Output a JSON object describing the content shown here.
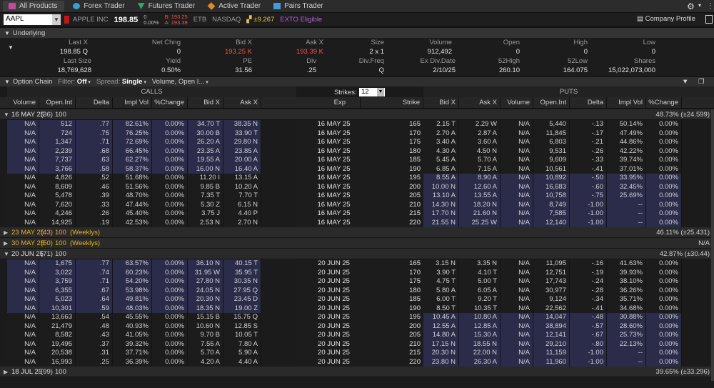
{
  "tabs": [
    {
      "label": "All Products"
    },
    {
      "label": "Forex Trader"
    },
    {
      "label": "Futures Trader"
    },
    {
      "label": "Active Trader"
    },
    {
      "label": "Pairs Trader"
    }
  ],
  "ticker": {
    "symbol": "AAPL",
    "name": "APPLE INC",
    "price": "198.85",
    "change": "0",
    "change_pct": "0.00%",
    "bid": "B: 193.25",
    "ask": "A: 193.39",
    "etb": "ETB",
    "exchange": "NASDAQ",
    "move": "±9.267",
    "exto": "EXTO Eligible",
    "company_profile": "Company Profile"
  },
  "underlying": {
    "title": "Underlying",
    "row1": [
      {
        "k": "Last X",
        "v": "198.85 Q"
      },
      {
        "k": "Net Chng",
        "v": "0"
      },
      {
        "k": "Bid X",
        "v": "193.25 K",
        "red": true
      },
      {
        "k": "Ask X",
        "v": "193.39 K",
        "red": true
      },
      {
        "k": "Size",
        "v": "2 x 1"
      },
      {
        "k": "Volume",
        "v": "912,492"
      },
      {
        "k": "Open",
        "v": "0"
      },
      {
        "k": "High",
        "v": "0"
      },
      {
        "k": "Low",
        "v": "0"
      }
    ],
    "row2": [
      {
        "k": "Last Size",
        "v": "18,769,628"
      },
      {
        "k": "Yield",
        "v": "0.50%"
      },
      {
        "k": "PE",
        "v": "31.56"
      },
      {
        "k": "Div",
        "v": ".25"
      },
      {
        "k": "Div.Freq",
        "v": "Q"
      },
      {
        "k": "Ex Div.Date",
        "v": "2/10/25"
      },
      {
        "k": "52High",
        "v": "260.10"
      },
      {
        "k": "52Low",
        "v": "164.075"
      },
      {
        "k": "Shares",
        "v": "15,022,073,000"
      },
      {
        "k": "Beta",
        "v": "1.276"
      }
    ]
  },
  "option_chain": {
    "title": "Option Chain",
    "filter_label": "Filter:",
    "filter": "Off",
    "spread_label": "Spread:",
    "spread": "Single",
    "layout": "Volume, Open I...",
    "calls": "CALLS",
    "puts": "PUTS",
    "strikes_label": "Strikes:",
    "strikes": "12"
  },
  "headers": {
    "calls": [
      "Volume",
      "Open.Int",
      "Delta",
      "Impl Vol",
      "%Change",
      "Bid X",
      "Ask X"
    ],
    "mid": [
      "Exp",
      "Strike"
    ],
    "puts": [
      "Bid X",
      "Ask X",
      "Volume",
      "Open.Int",
      "Delta",
      "Impl Vol",
      "%Change"
    ]
  },
  "groups": [
    {
      "date": "16 MAY 25",
      "days": "(36)",
      "mult": "100",
      "weekly": "",
      "iv": "48.73% (±24.599)",
      "open": true,
      "gold": false,
      "rows": [
        {
          "c": [
            "N/A",
            "512",
            ".77",
            "82.61%",
            "0.00%",
            "34.70 T",
            "38.35 N"
          ],
          "exp": "16 MAY 25",
          "strike": "165",
          "p": [
            "2.15 T",
            "2.29 W",
            "N/A",
            "5,440",
            "-.13",
            "50.14%",
            "0.00%"
          ]
        },
        {
          "c": [
            "N/A",
            "724",
            ".75",
            "76.25%",
            "0.00%",
            "30.00 B",
            "33.90 T"
          ],
          "exp": "16 MAY 25",
          "strike": "170",
          "p": [
            "2.70 A",
            "2.87 A",
            "N/A",
            "11,845",
            "-.17",
            "47.49%",
            "0.00%"
          ]
        },
        {
          "c": [
            "N/A",
            "1,347",
            ".71",
            "72.69%",
            "0.00%",
            "26.20 A",
            "29.80 N"
          ],
          "exp": "16 MAY 25",
          "strike": "175",
          "p": [
            "3.40 A",
            "3.60 A",
            "N/A",
            "6,803",
            "-.21",
            "44.86%",
            "0.00%"
          ]
        },
        {
          "c": [
            "N/A",
            "2,239",
            ".68",
            "66.45%",
            "0.00%",
            "23.35 A",
            "23.85 A"
          ],
          "exp": "16 MAY 25",
          "strike": "180",
          "p": [
            "4.30 A",
            "4.50 N",
            "N/A",
            "9,531",
            "-.26",
            "42.22%",
            "0.00%"
          ]
        },
        {
          "c": [
            "N/A",
            "7,737",
            ".63",
            "62.27%",
            "0.00%",
            "19.55 A",
            "20.00 A"
          ],
          "exp": "16 MAY 25",
          "strike": "185",
          "p": [
            "5.45 A",
            "5.70 A",
            "N/A",
            "9,609",
            "-.33",
            "39.74%",
            "0.00%"
          ]
        },
        {
          "c": [
            "N/A",
            "3,766",
            ".58",
            "58.37%",
            "0.00%",
            "16.00 N",
            "16.40 A"
          ],
          "exp": "16 MAY 25",
          "strike": "190",
          "p": [
            "6.85 A",
            "7.15 A",
            "N/A",
            "10,561",
            "-.41",
            "37.01%",
            "0.00%"
          ]
        },
        {
          "c": [
            "N/A",
            "4,826",
            ".52",
            "51.68%",
            "0.00%",
            "11.20 I",
            "13.15 A"
          ],
          "exp": "16 MAY 25",
          "strike": "195",
          "p": [
            "8.55 A",
            "8.90 A",
            "N/A",
            "10,892",
            "-.50",
            "33.95%",
            "0.00%"
          ]
        },
        {
          "c": [
            "N/A",
            "8,609",
            ".46",
            "51.56%",
            "0.00%",
            "9.85 B",
            "10.20 A"
          ],
          "exp": "16 MAY 25",
          "strike": "200",
          "p": [
            "10.00 N",
            "12.60 A",
            "N/A",
            "16,683",
            "-.60",
            "32.45%",
            "0.00%"
          ]
        },
        {
          "c": [
            "N/A",
            "5,478",
            ".39",
            "48.70%",
            "0.00%",
            "7.35 T",
            "7.70 T"
          ],
          "exp": "16 MAY 25",
          "strike": "205",
          "p": [
            "13.10 A",
            "13.55 A",
            "N/A",
            "10,758",
            "-.75",
            "25.69%",
            "0.00%"
          ]
        },
        {
          "c": [
            "N/A",
            "7,620",
            ".33",
            "47.44%",
            "0.00%",
            "5.30 Z",
            "6.15 N"
          ],
          "exp": "16 MAY 25",
          "strike": "210",
          "p": [
            "14.30 N",
            "18.20 N",
            "N/A",
            "8,749",
            "-1.00",
            "--",
            "0.00%"
          ]
        },
        {
          "c": [
            "N/A",
            "4,246",
            ".26",
            "45.40%",
            "0.00%",
            "3.75 J",
            "4.40 P"
          ],
          "exp": "16 MAY 25",
          "strike": "215",
          "p": [
            "17.70 N",
            "21.60 N",
            "N/A",
            "7,585",
            "-1.00",
            "--",
            "0.00%"
          ]
        },
        {
          "c": [
            "N/A",
            "14,925",
            ".19",
            "42.53%",
            "0.00%",
            "2.53 N",
            "2.70 N"
          ],
          "exp": "16 MAY 25",
          "strike": "220",
          "p": [
            "21.55 N",
            "25.25 W",
            "N/A",
            "12,140",
            "-1.00",
            "--",
            "0.00%"
          ]
        }
      ]
    },
    {
      "date": "23 MAY 25",
      "days": "(43)",
      "mult": "100",
      "weekly": "(Weeklys)",
      "iv": "46.11% (±25.431)",
      "open": false,
      "gold": true,
      "rows": []
    },
    {
      "date": "30 MAY 25",
      "days": "(50)",
      "mult": "100",
      "weekly": "(Weeklys)",
      "iv": "N/A",
      "open": false,
      "gold": true,
      "rows": []
    },
    {
      "date": "20 JUN 25",
      "days": "(71)",
      "mult": "100",
      "weekly": "",
      "iv": "42.87% (±30.44)",
      "open": true,
      "gold": false,
      "rows": [
        {
          "c": [
            "N/A",
            "1,675",
            ".77",
            "63.57%",
            "0.00%",
            "36.10 N",
            "40.15 T"
          ],
          "exp": "20 JUN 25",
          "strike": "165",
          "p": [
            "3.15 N",
            "3.35 N",
            "N/A",
            "11,095",
            "-.16",
            "41.63%",
            "0.00%"
          ]
        },
        {
          "c": [
            "N/A",
            "3,022",
            ".74",
            "60.23%",
            "0.00%",
            "31.95 W",
            "35.95 T"
          ],
          "exp": "20 JUN 25",
          "strike": "170",
          "p": [
            "3.90 T",
            "4.10 T",
            "N/A",
            "12,751",
            "-.19",
            "39.93%",
            "0.00%"
          ]
        },
        {
          "c": [
            "N/A",
            "3,759",
            ".71",
            "54.20%",
            "0.00%",
            "27.80 N",
            "30.35 N"
          ],
          "exp": "20 JUN 25",
          "strike": "175",
          "p": [
            "4.75 T",
            "5.00 T",
            "N/A",
            "17,743",
            "-.24",
            "38.10%",
            "0.00%"
          ]
        },
        {
          "c": [
            "N/A",
            "6,355",
            ".67",
            "53.98%",
            "0.00%",
            "24.05 N",
            "27.95 Q"
          ],
          "exp": "20 JUN 25",
          "strike": "180",
          "p": [
            "5.80 A",
            "6.05 A",
            "N/A",
            "30,977",
            "-.28",
            "36.26%",
            "0.00%"
          ]
        },
        {
          "c": [
            "N/A",
            "5,023",
            ".64",
            "49.81%",
            "0.00%",
            "20.30 N",
            "23.45 D"
          ],
          "exp": "20 JUN 25",
          "strike": "185",
          "p": [
            "6.00 T",
            "9.20 T",
            "N/A",
            "9,124",
            "-.34",
            "35.71%",
            "0.00%"
          ]
        },
        {
          "c": [
            "N/A",
            "10,301",
            ".59",
            "48.03%",
            "0.00%",
            "18.35 N",
            "19.00 Z"
          ],
          "exp": "20 JUN 25",
          "strike": "190",
          "p": [
            "8.50 T",
            "10.35 T",
            "N/A",
            "22,562",
            "-.41",
            "34.68%",
            "0.00%"
          ]
        },
        {
          "c": [
            "N/A",
            "13,663",
            ".54",
            "45.55%",
            "0.00%",
            "15.15 B",
            "15.75 Q"
          ],
          "exp": "20 JUN 25",
          "strike": "195",
          "p": [
            "10.45 A",
            "10.80 A",
            "N/A",
            "14,047",
            "-.48",
            "30.88%",
            "0.00%"
          ]
        },
        {
          "c": [
            "N/A",
            "21,479",
            ".48",
            "40.93%",
            "0.00%",
            "10.60 N",
            "12.85 S"
          ],
          "exp": "20 JUN 25",
          "strike": "200",
          "p": [
            "12.55 A",
            "12.85 A",
            "N/A",
            "38,894",
            "-.57",
            "28.60%",
            "0.00%"
          ]
        },
        {
          "c": [
            "N/A",
            "8,582",
            ".43",
            "41.05%",
            "0.00%",
            "9.70 B",
            "10.05 T"
          ],
          "exp": "20 JUN 25",
          "strike": "205",
          "p": [
            "14.80 A",
            "15.30 A",
            "N/A",
            "12,141",
            "-.67",
            "25.73%",
            "0.00%"
          ]
        },
        {
          "c": [
            "N/A",
            "19,495",
            ".37",
            "39.32%",
            "0.00%",
            "7.55 A",
            "7.80 A"
          ],
          "exp": "20 JUN 25",
          "strike": "210",
          "p": [
            "17.15 N",
            "18.55 N",
            "N/A",
            "29,210",
            "-.80",
            "22.13%",
            "0.00%"
          ]
        },
        {
          "c": [
            "N/A",
            "20,538",
            ".31",
            "37.71%",
            "0.00%",
            "5.70 A",
            "5.90 A"
          ],
          "exp": "20 JUN 25",
          "strike": "215",
          "p": [
            "20.30 N",
            "22.00 N",
            "N/A",
            "11,159",
            "-1.00",
            "--",
            "0.00%"
          ]
        },
        {
          "c": [
            "N/A",
            "16,993",
            ".25",
            "36.39%",
            "0.00%",
            "4.20 A",
            "4.40 A"
          ],
          "exp": "20 JUN 25",
          "strike": "220",
          "p": [
            "23.80 N",
            "26.30 A",
            "N/A",
            "11,960",
            "-1.00",
            "--",
            "0.00%"
          ]
        }
      ]
    },
    {
      "date": "18 JUL 25",
      "days": "(99)",
      "mult": "100",
      "weekly": "",
      "iv": "39.65% (±33.296)",
      "open": false,
      "gold": false,
      "rows": []
    }
  ]
}
